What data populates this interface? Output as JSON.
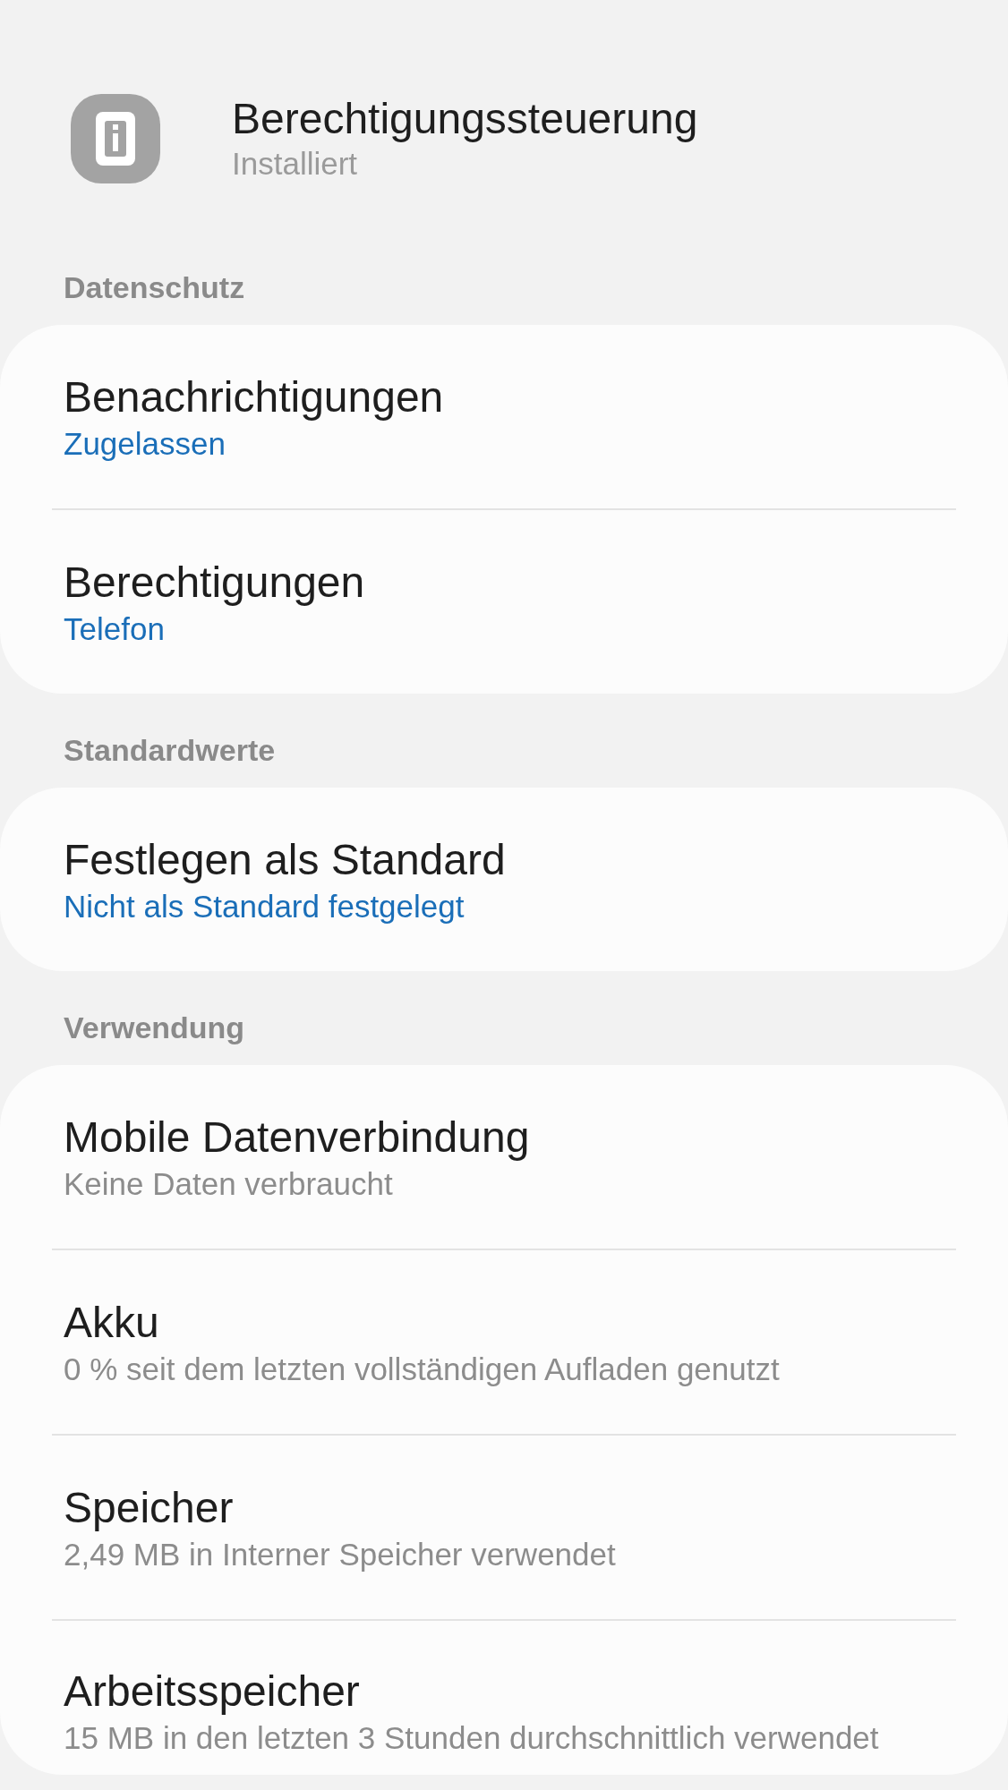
{
  "app": {
    "title": "Berechtigungssteuerung",
    "status": "Installiert"
  },
  "sections": [
    {
      "header": "Datenschutz",
      "items": [
        {
          "title": "Benachrichtigungen",
          "subtitle": "Zugelassen",
          "kind": "setting"
        },
        {
          "title": "Berechtigungen",
          "subtitle": "Telefon",
          "kind": "setting"
        }
      ]
    },
    {
      "header": "Standardwerte",
      "items": [
        {
          "title": "Festlegen als Standard",
          "subtitle": "Nicht als Standard festgelegt",
          "kind": "setting"
        }
      ]
    },
    {
      "header": "Verwendung",
      "items": [
        {
          "title": "Mobile Datenverbindung",
          "subtitle": "Keine Daten verbraucht",
          "kind": "usage"
        },
        {
          "title": "Akku",
          "subtitle": "0 % seit dem letzten vollständigen Aufladen genutzt",
          "kind": "usage"
        },
        {
          "title": "Speicher",
          "subtitle": "2,49 MB in Interner Speicher verwendet",
          "kind": "usage"
        },
        {
          "title": "Arbeitsspeicher",
          "subtitle": "15 MB in den letzten 3 Stunden durchschnittlich verwendet",
          "kind": "usage"
        }
      ]
    }
  ]
}
